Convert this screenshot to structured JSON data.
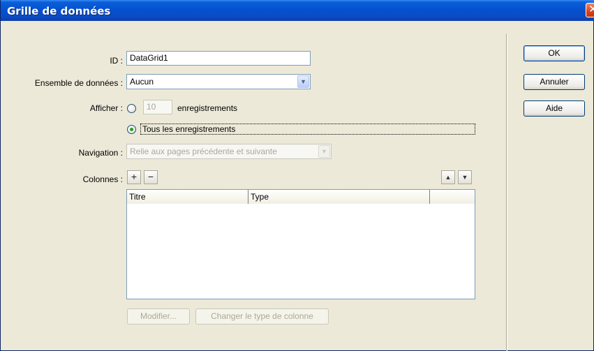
{
  "window": {
    "title": "Grille de données",
    "close_glyph": "✕"
  },
  "form": {
    "id": {
      "label": "ID :",
      "value": "DataGrid1"
    },
    "dataset": {
      "label": "Ensemble de données :",
      "value": "Aucun"
    },
    "show": {
      "label": "Afficher :",
      "count_value": "10",
      "count_suffix": "enregistrements",
      "all_label": "Tous les enregistrements",
      "selected": "all"
    },
    "navigation": {
      "label": "Navigation :",
      "value": "Relie aux pages précédente et suivante",
      "disabled": true
    },
    "columns": {
      "label": "Colonnes :",
      "add_glyph": "+",
      "remove_glyph": "−",
      "up_glyph": "▲",
      "down_glyph": "▼",
      "headers": [
        "Titre",
        "Type",
        ""
      ],
      "rows": []
    },
    "modify_label": "Modifier...",
    "change_type_label": "Changer le type de colonne"
  },
  "buttons": {
    "ok": "OK",
    "cancel": "Annuler",
    "help": "Aide"
  },
  "icons": {
    "dropdown": "chevron-down-icon",
    "close": "close-icon"
  },
  "colors": {
    "titlebar": "#0551d0",
    "close": "#d8431e",
    "dialog_bg": "#ece9d8",
    "radio_dot": "#21a121"
  }
}
